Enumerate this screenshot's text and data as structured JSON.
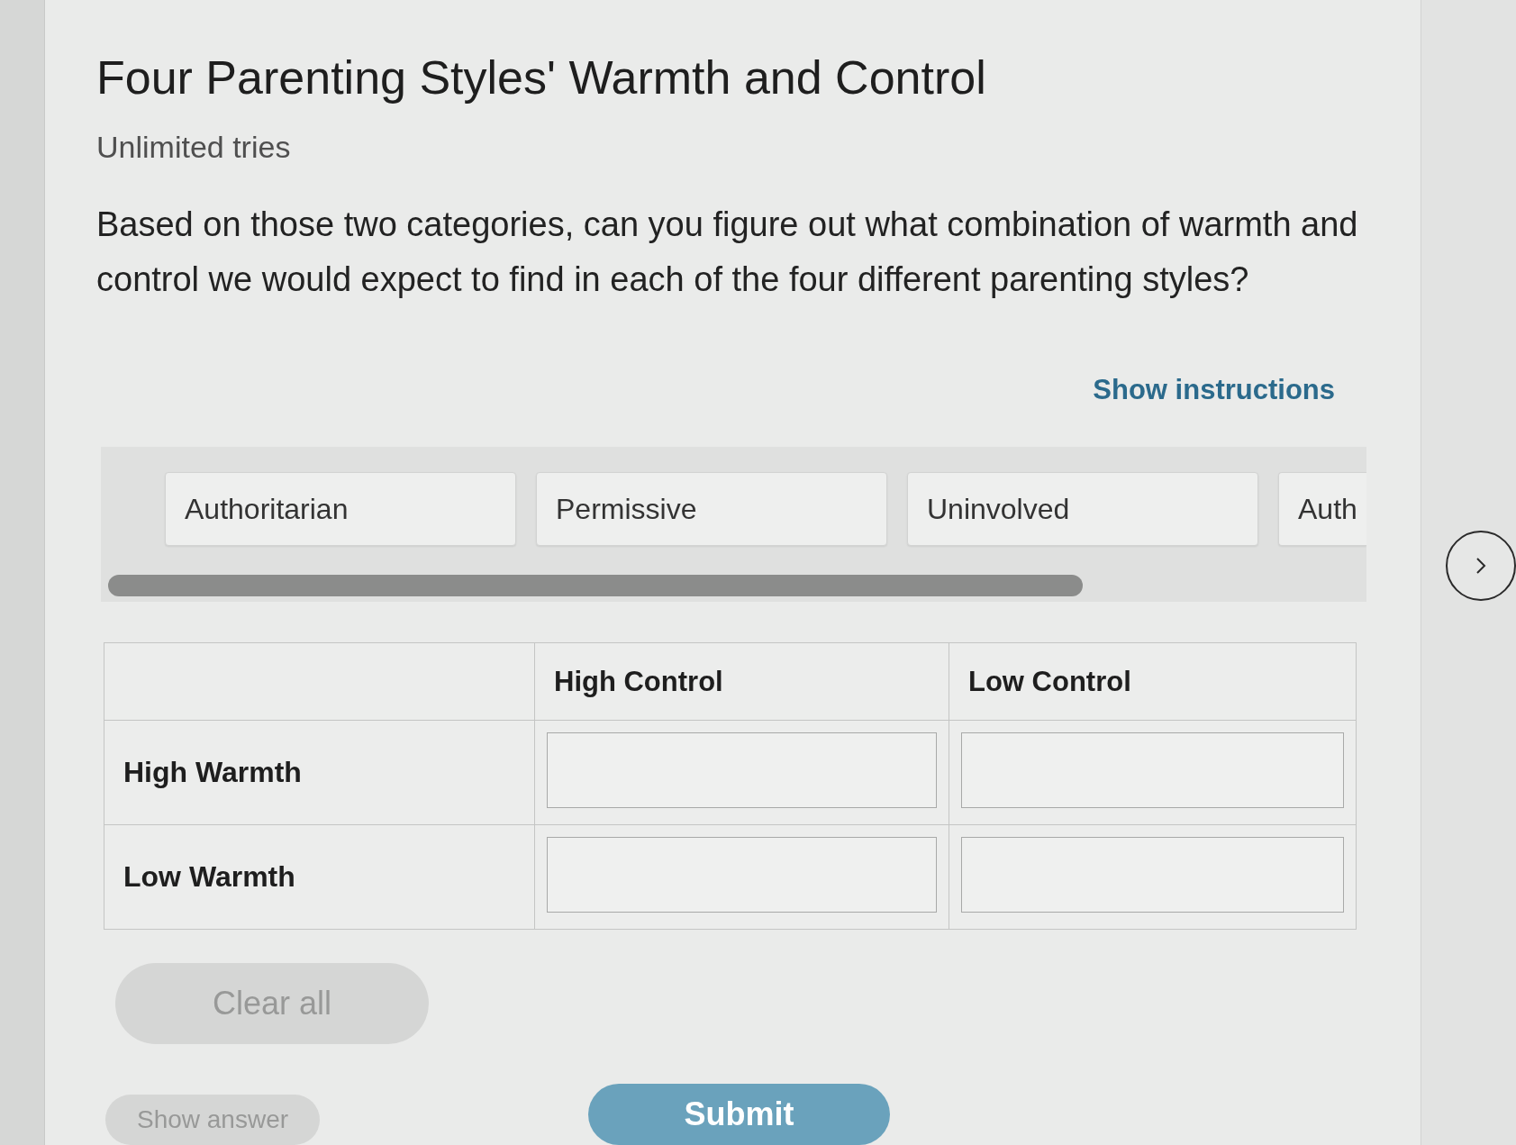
{
  "title": "Four Parenting Styles' Warmth and Control",
  "attempts": "Unlimited tries",
  "question": "Based on those two categories, can you figure out what combination of warmth and control we would expect to find in each of the four different parenting styles?",
  "instructions_link": "Show instructions",
  "answer_bank": {
    "items": [
      "Authoritarian",
      "Permissive",
      "Uninvolved",
      "Auth"
    ]
  },
  "table": {
    "columns": [
      "High Control",
      "Low Control"
    ],
    "rows": [
      {
        "label": "High Warmth"
      },
      {
        "label": "Low Warmth"
      }
    ]
  },
  "buttons": [
    {
      "label": "Clear all",
      "kind": "secondary",
      "disabled": true
    },
    {
      "label": "Show answer",
      "kind": "secondary",
      "disabled": true
    },
    {
      "label": "Submit",
      "kind": "primary",
      "disabled": false
    }
  ]
}
